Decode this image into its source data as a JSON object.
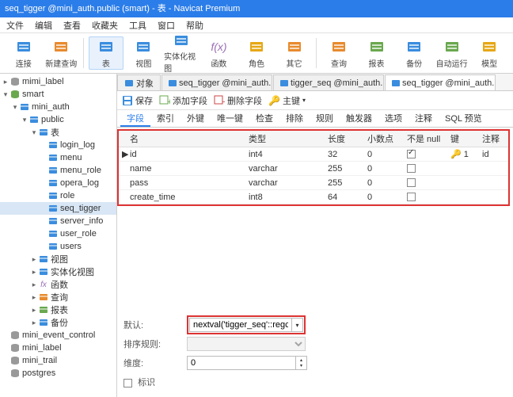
{
  "window_title": "seq_tigger @mini_auth.public (smart) - 表 - Navicat Premium",
  "menubar": [
    "文件",
    "编辑",
    "查看",
    "收藏夹",
    "工具",
    "窗口",
    "帮助"
  ],
  "toolbar": [
    {
      "label": "连接",
      "name": "connect",
      "color": "#3a8dde"
    },
    {
      "label": "新建查询",
      "name": "new-query",
      "color": "#e88b2e"
    },
    {
      "sep": true
    },
    {
      "label": "表",
      "name": "tables",
      "color": "#3a8dde",
      "active": true
    },
    {
      "label": "视图",
      "name": "views",
      "color": "#3a8dde"
    },
    {
      "label": "实体化视图",
      "name": "mat-views",
      "color": "#3a8dde"
    },
    {
      "label": "函数",
      "name": "functions",
      "color": "#9a6fb5",
      "fx": true
    },
    {
      "label": "角色",
      "name": "roles",
      "color": "#e6a817"
    },
    {
      "label": "其它",
      "name": "others",
      "color": "#e88b2e"
    },
    {
      "sep": true
    },
    {
      "label": "查询",
      "name": "query",
      "color": "#e88b2e"
    },
    {
      "label": "报表",
      "name": "reports",
      "color": "#6aa84f"
    },
    {
      "label": "备份",
      "name": "backup",
      "color": "#3a8dde"
    },
    {
      "label": "自动运行",
      "name": "automation",
      "color": "#6aa84f"
    },
    {
      "label": "模型",
      "name": "model",
      "color": "#e6a817"
    }
  ],
  "tree": [
    {
      "indent": 0,
      "twisty": "▸",
      "icon": "db",
      "label": "mimi_label",
      "color": "#999"
    },
    {
      "indent": 0,
      "twisty": "▾",
      "icon": "db",
      "label": "smart",
      "color": "#6aa84f"
    },
    {
      "indent": 1,
      "twisty": "▾",
      "icon": "pg",
      "label": "mini_auth",
      "color": "#3a8dde"
    },
    {
      "indent": 2,
      "twisty": "▾",
      "icon": "schema",
      "label": "public",
      "color": "#3a8dde"
    },
    {
      "indent": 3,
      "twisty": "▾",
      "icon": "folder",
      "label": "表",
      "color": "#3a8dde"
    },
    {
      "indent": 4,
      "twisty": "",
      "icon": "table",
      "label": "login_log",
      "color": "#3a8dde"
    },
    {
      "indent": 4,
      "twisty": "",
      "icon": "table",
      "label": "menu",
      "color": "#3a8dde"
    },
    {
      "indent": 4,
      "twisty": "",
      "icon": "table",
      "label": "menu_role",
      "color": "#3a8dde"
    },
    {
      "indent": 4,
      "twisty": "",
      "icon": "table",
      "label": "opera_log",
      "color": "#3a8dde"
    },
    {
      "indent": 4,
      "twisty": "",
      "icon": "table",
      "label": "role",
      "color": "#3a8dde"
    },
    {
      "indent": 4,
      "twisty": "",
      "icon": "table",
      "label": "seq_tigger",
      "color": "#3a8dde",
      "selected": true
    },
    {
      "indent": 4,
      "twisty": "",
      "icon": "table",
      "label": "server_info",
      "color": "#3a8dde"
    },
    {
      "indent": 4,
      "twisty": "",
      "icon": "table",
      "label": "user_role",
      "color": "#3a8dde"
    },
    {
      "indent": 4,
      "twisty": "",
      "icon": "table",
      "label": "users",
      "color": "#3a8dde"
    },
    {
      "indent": 3,
      "twisty": "▸",
      "icon": "view",
      "label": "视图",
      "color": "#3a8dde"
    },
    {
      "indent": 3,
      "twisty": "▸",
      "icon": "mview",
      "label": "实体化视图",
      "color": "#3a8dde"
    },
    {
      "indent": 3,
      "twisty": "▸",
      "icon": "fx",
      "label": "函数",
      "color": "#9a6fb5"
    },
    {
      "indent": 3,
      "twisty": "▸",
      "icon": "query",
      "label": "查询",
      "color": "#e88b2e"
    },
    {
      "indent": 3,
      "twisty": "▸",
      "icon": "report",
      "label": "报表",
      "color": "#6aa84f"
    },
    {
      "indent": 3,
      "twisty": "▸",
      "icon": "backup",
      "label": "备份",
      "color": "#3a8dde"
    },
    {
      "indent": 0,
      "twisty": "",
      "icon": "db",
      "label": "mini_event_control",
      "color": "#999"
    },
    {
      "indent": 0,
      "twisty": "",
      "icon": "db",
      "label": "mini_label",
      "color": "#999"
    },
    {
      "indent": 0,
      "twisty": "",
      "icon": "db",
      "label": "mini_trail",
      "color": "#999"
    },
    {
      "indent": 0,
      "twisty": "",
      "icon": "db",
      "label": "postgres",
      "color": "#999"
    }
  ],
  "tabs": [
    {
      "label": "对象",
      "icon": "bars",
      "active": false
    },
    {
      "label": "seq_tigger @mini_auth.publi...",
      "icon": "table",
      "active": false
    },
    {
      "label": "tigger_seq @mini_auth.publi...",
      "icon": "serial",
      "active": false
    },
    {
      "label": "seq_tigger @mini_auth.publi...",
      "icon": "table",
      "active": true
    }
  ],
  "subtoolbar": {
    "save": "保存",
    "add_field": "添加字段",
    "del_field": "删除字段",
    "pk": "主键"
  },
  "inner_tabs": [
    "字段",
    "索引",
    "外键",
    "唯一键",
    "检查",
    "排除",
    "规则",
    "触发器",
    "选项",
    "注释",
    "SQL 预览"
  ],
  "inner_active": "字段",
  "grid": {
    "headers": [
      "名",
      "类型",
      "长度",
      "小数点",
      "不是 null",
      "键",
      "注释"
    ],
    "rows": [
      {
        "name": "id",
        "type": "int4",
        "len": "32",
        "dec": "0",
        "nn": true,
        "key": "1",
        "comment": "id",
        "sel": true
      },
      {
        "name": "name",
        "type": "varchar",
        "len": "255",
        "dec": "0",
        "nn": false,
        "key": "",
        "comment": ""
      },
      {
        "name": "pass",
        "type": "varchar",
        "len": "255",
        "dec": "0",
        "nn": false,
        "key": "",
        "comment": ""
      },
      {
        "name": "create_time",
        "type": "int8",
        "len": "64",
        "dec": "0",
        "nn": false,
        "key": "",
        "comment": ""
      }
    ]
  },
  "bottom": {
    "default_lbl": "默认:",
    "default_val": "nextval('tigger_seq'::regclass)",
    "sort_lbl": "排序规则:",
    "sort_val": "",
    "dim_lbl": "维度:",
    "dim_val": "0",
    "flag_lbl": "标识"
  }
}
